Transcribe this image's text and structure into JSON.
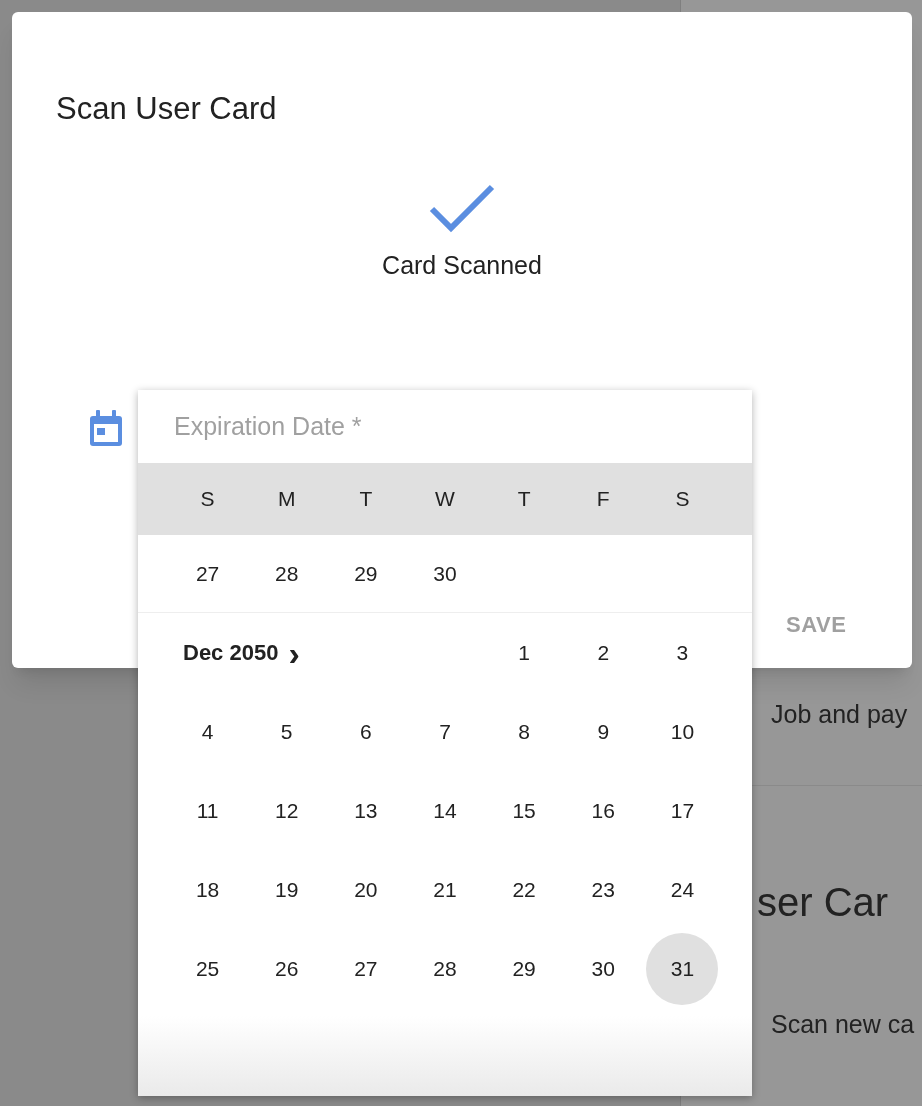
{
  "background_page": {
    "texts": [
      {
        "kind": "body",
        "text": "Job and pay"
      },
      {
        "kind": "title",
        "text": "ser Car"
      },
      {
        "kind": "body",
        "text": "Scan new ca"
      }
    ]
  },
  "dialog": {
    "title": "Scan User Card",
    "status": "Card Scanned",
    "date_field": {
      "placeholder": "Expiration Date *"
    },
    "save_button": {
      "label": "SAVE",
      "disabled": true
    }
  },
  "date_picker": {
    "weekdays": [
      "S",
      "M",
      "T",
      "W",
      "T",
      "F",
      "S"
    ],
    "previous_month_days": [
      {
        "day": "27",
        "selected": false
      },
      {
        "day": "28",
        "selected": false
      },
      {
        "day": "29",
        "selected": false
      },
      {
        "day": "30",
        "selected": false
      }
    ],
    "month": {
      "label": "Dec 2050",
      "next_icon": "›",
      "days": [
        {
          "day": "1",
          "selected": false
        },
        {
          "day": "2",
          "selected": false
        },
        {
          "day": "3",
          "selected": false
        },
        {
          "day": "4",
          "selected": false
        },
        {
          "day": "5",
          "selected": false
        },
        {
          "day": "6",
          "selected": false
        },
        {
          "day": "7",
          "selected": false
        },
        {
          "day": "8",
          "selected": false
        },
        {
          "day": "9",
          "selected": false
        },
        {
          "day": "10",
          "selected": false
        },
        {
          "day": "11",
          "selected": false
        },
        {
          "day": "12",
          "selected": false
        },
        {
          "day": "13",
          "selected": false
        },
        {
          "day": "14",
          "selected": false
        },
        {
          "day": "15",
          "selected": false
        },
        {
          "day": "16",
          "selected": false
        },
        {
          "day": "17",
          "selected": false
        },
        {
          "day": "18",
          "selected": false
        },
        {
          "day": "19",
          "selected": false
        },
        {
          "day": "20",
          "selected": false
        },
        {
          "day": "21",
          "selected": false
        },
        {
          "day": "22",
          "selected": false
        },
        {
          "day": "23",
          "selected": false
        },
        {
          "day": "24",
          "selected": false
        },
        {
          "day": "25",
          "selected": false
        },
        {
          "day": "26",
          "selected": false
        },
        {
          "day": "27",
          "selected": false
        },
        {
          "day": "28",
          "selected": false
        },
        {
          "day": "29",
          "selected": false
        },
        {
          "day": "30",
          "selected": false
        },
        {
          "day": "31",
          "selected": true
        }
      ]
    }
  }
}
